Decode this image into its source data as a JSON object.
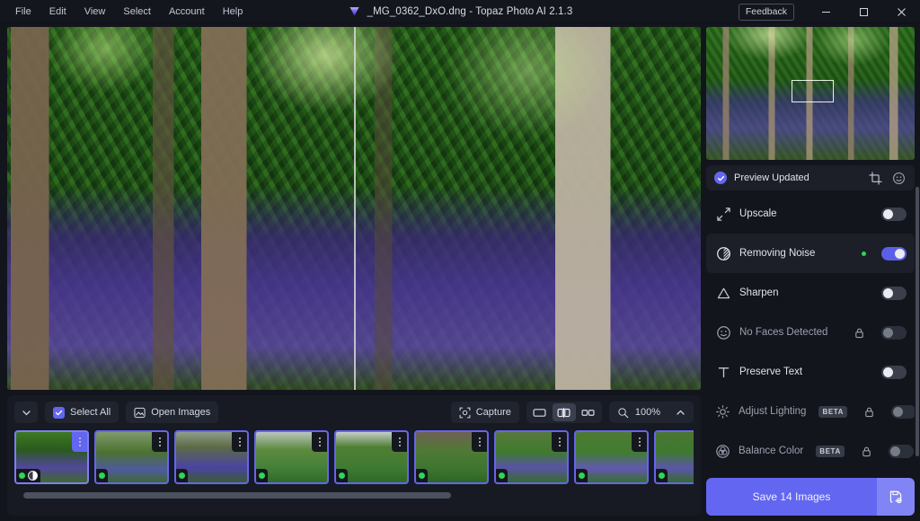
{
  "titlebar": {
    "menus": [
      "File",
      "Edit",
      "View",
      "Select",
      "Account",
      "Help"
    ],
    "title": "_MG_0362_DxO.dng - Topaz Photo AI 2.1.3",
    "logo_icon": "topaz-gem-icon",
    "feedback_label": "Feedback",
    "minimize_icon": "minimize-icon",
    "maximize_icon": "maximize-icon",
    "close_icon": "close-icon"
  },
  "preview": {
    "mode": "split-view",
    "split_position": "50%"
  },
  "filmstrip": {
    "collapse_icon": "chevron-down-icon",
    "select_all_label": "Select All",
    "select_all_checked": true,
    "open_images_label": "Open Images",
    "open_images_icon": "image-icon",
    "capture_label": "Capture",
    "capture_icon": "capture-icon",
    "view_modes": [
      {
        "name": "single-view",
        "icon": "single-pane-icon",
        "active": false
      },
      {
        "name": "split-view",
        "icon": "split-pane-icon",
        "active": true
      },
      {
        "name": "side-by-side-view",
        "icon": "dual-pane-icon",
        "active": false
      }
    ],
    "zoom_icon": "magnifier-icon",
    "zoom_level": "100%",
    "zoom_chevron": "chevron-up-icon",
    "thumbnails": [
      {
        "selected": true,
        "status": "green",
        "badge": "noise-icon"
      },
      {
        "selected": false,
        "status": "green",
        "badge": null
      },
      {
        "selected": false,
        "status": "green",
        "badge": null
      },
      {
        "selected": false,
        "status": "green",
        "badge": null
      },
      {
        "selected": false,
        "status": "green",
        "badge": null
      },
      {
        "selected": false,
        "status": "green",
        "badge": null
      },
      {
        "selected": false,
        "status": "green",
        "badge": null
      },
      {
        "selected": false,
        "status": "green",
        "badge": null
      },
      {
        "selected": false,
        "status": "green",
        "badge": null
      }
    ],
    "scroll_position": "start"
  },
  "right_panel": {
    "navigator": {
      "viewport_overlay": true
    },
    "status": {
      "label": "Preview Updated",
      "check_icon": "check-circle-icon",
      "crop_icon": "crop-icon",
      "face_icon": "face-icon"
    },
    "enhancements": [
      {
        "label": "Upscale",
        "icon": "upscale-arrows-icon",
        "toggle": "off",
        "active": false,
        "beta": false,
        "locked": false,
        "dot": false
      },
      {
        "label": "Removing Noise",
        "icon": "noise-circle-icon",
        "toggle": "on",
        "active": true,
        "beta": false,
        "locked": false,
        "dot": true
      },
      {
        "label": "Sharpen",
        "icon": "triangle-icon",
        "toggle": "off",
        "active": false,
        "beta": false,
        "locked": false,
        "dot": false
      },
      {
        "label": "No Faces Detected",
        "icon": "face-icon",
        "toggle": "disabled",
        "active": false,
        "beta": false,
        "locked": true,
        "dot": false
      },
      {
        "label": "Preserve Text",
        "icon": "text-t-icon",
        "toggle": "off",
        "active": false,
        "beta": false,
        "locked": false,
        "dot": false
      },
      {
        "label": "Adjust Lighting",
        "icon": "sun-icon",
        "toggle": "disabled",
        "active": false,
        "beta": true,
        "locked": true,
        "dot": false
      },
      {
        "label": "Balance Color",
        "icon": "color-wheel-icon",
        "toggle": "disabled",
        "active": false,
        "beta": true,
        "locked": true,
        "dot": false
      }
    ],
    "beta_label": "BETA",
    "save_button": {
      "label": "Save 14 Images",
      "settings_icon": "save-settings-icon"
    }
  },
  "colors": {
    "accent": "#6366f1",
    "status_green": "#2fd655",
    "panel_bg": "#13151c",
    "row_bg": "#1c1f28"
  }
}
